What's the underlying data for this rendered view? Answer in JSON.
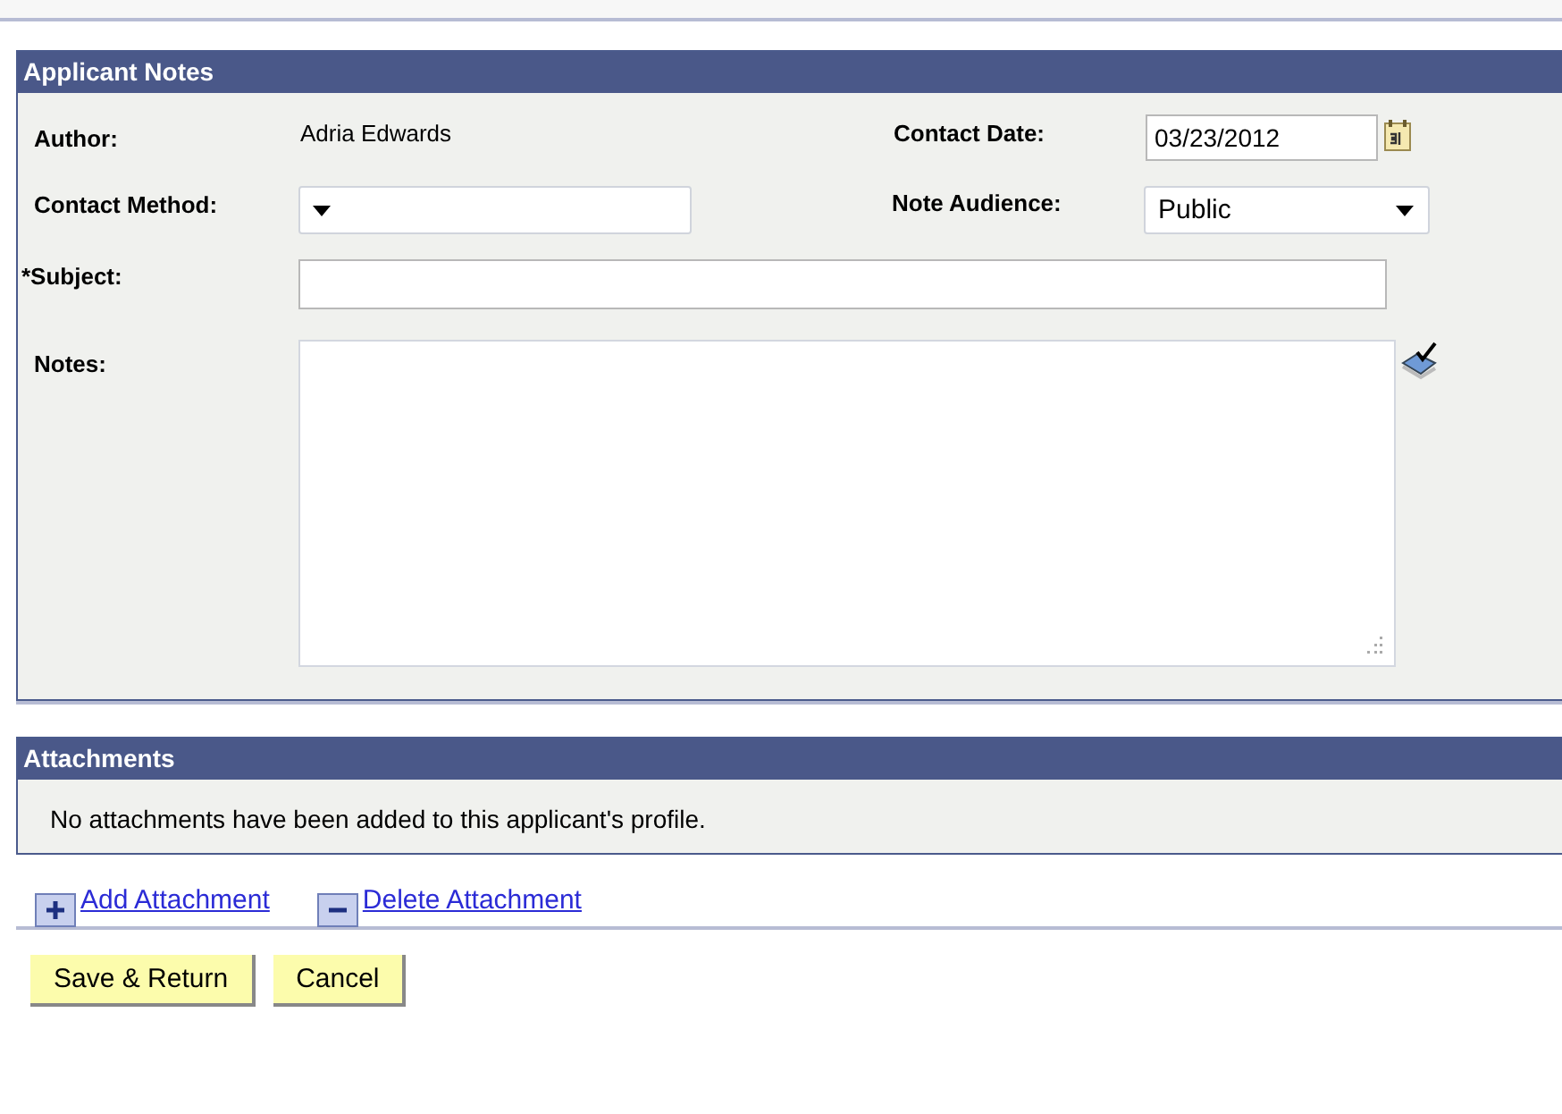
{
  "notes_panel": {
    "title": "Applicant Notes",
    "author": {
      "label": "Author:",
      "value": "Adria Edwards"
    },
    "contact_date": {
      "label": "Contact Date:",
      "value": "03/23/2012"
    },
    "contact_method": {
      "label": "Contact Method:"
    },
    "note_audience": {
      "label": "Note Audience:",
      "value": "Public"
    },
    "subject": {
      "label": "Subject:",
      "required_mark": "*"
    },
    "notes": {
      "label": "Notes:"
    }
  },
  "attachments_panel": {
    "title": "Attachments",
    "message": "No attachments have been added to this applicant's profile."
  },
  "links": [
    {
      "kind": "add",
      "label": "Add Attachment"
    },
    {
      "kind": "delete",
      "label": "Delete Attachment"
    }
  ],
  "buttons": [
    "Save & Return",
    "Cancel"
  ]
}
